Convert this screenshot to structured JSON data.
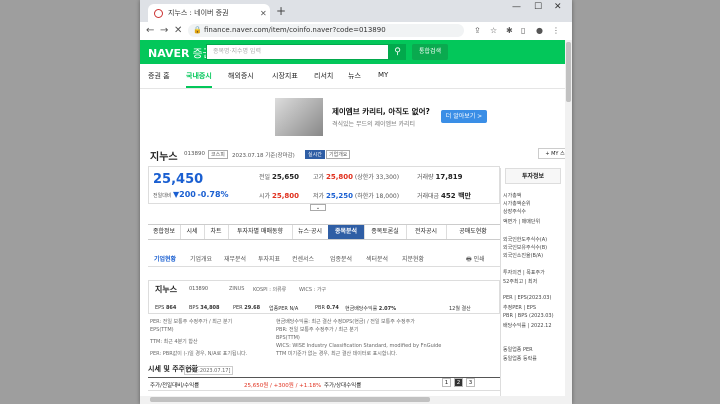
{
  "browser": {
    "tab_title": "지누스 : 네이버 증권",
    "url": "finance.naver.com/item/coinfo.naver?code=013890"
  },
  "header": {
    "logo": "NAVER",
    "logo_sub": "증권",
    "search_placeholder": "종목명·지수명 입력",
    "search_button": "통합검색"
  },
  "nav": {
    "items": [
      "증권 홈",
      "국내증시",
      "해외증시",
      "시장지표",
      "리서치",
      "뉴스",
      "MY"
    ]
  },
  "ad": {
    "headline": "제이엠브 카리티, 아직도 없어?",
    "sub": "격식있는 무드의 제이엠브 카리티",
    "button": "더 알아보기 >"
  },
  "stock": {
    "name": "지누스",
    "code": "013890",
    "market_tag": "코스피",
    "date": "2023.07.18 기준(장마감)",
    "tag1": "실시간",
    "tag2": "기업개요",
    "my_stock": "+ MY 스",
    "price": "25,450",
    "change_label": "전일대비",
    "change": "▼200",
    "change_pct": "-0.78%",
    "prev_label": "전일",
    "prev": "25,650",
    "high_label": "고가",
    "high": "25,800",
    "high_limit": "(상한가 33,300)",
    "volume_label": "거래량",
    "volume": "17,819",
    "open_label": "시가",
    "open": "25,800",
    "low_label": "저가",
    "low": "25,250",
    "low_limit": "(하한가 18,000)",
    "amount_label": "거래대금",
    "amount": "452 백만"
  },
  "tabs": [
    "종합정보",
    "시세",
    "차트",
    "투자자별 매매동향",
    "뉴스·공시",
    "종목분석",
    "종목토론실",
    "전자공시",
    "공매도현황"
  ],
  "subtabs": [
    "기업현황",
    "기업개요",
    "재무분석",
    "투자지표",
    "컨센서스",
    "업종분석",
    "섹터분석",
    "지분현황"
  ],
  "print_label": "인쇄",
  "company": {
    "name": "지누스",
    "code": "013890",
    "info1": "ZINUS",
    "info2": "KOSPI : 의류류",
    "info3": "WICS : 가구",
    "eps_label": "EPS",
    "eps": "864",
    "bps_label": "BPS",
    "bps": "34,808",
    "per_label": "PER",
    "per": "29.68",
    "iper_label": "업종PER N/A",
    "pbr_label": "PBR",
    "pbr": "0.74",
    "div_label": "현금배당수익률",
    "div": "2.07%",
    "fy": "12월 결산"
  },
  "notes": {
    "left": [
      "PER: 전일 보통주 수정주가 / 최근 분기",
      "EPS(TTM)",
      "TTM: 최근 4분기 합산",
      "PER: PBR값이 (-)일 경우, N/A로 표기됩니다."
    ],
    "right": [
      "현금배당수익률: 최근 결산 수정DPS(현금) / 전일 보통주 수정주가",
      "PBR: 전일 보통주 수정주가 / 최근 분기",
      "BPS(TTM)",
      "WICS: WISE Industry Classification Standard, modified by FnGuide",
      "TTM 미기준가 없는 경우, 최근 결산 데이터로 표시합니다."
    ]
  },
  "price_section": {
    "title": "시세 및 주주현황",
    "date": "[기준:2023.07.17]",
    "row_label1": "주가/전일대비/수익률",
    "row_value1": "25,650원 / +300원 / +1.18%",
    "row_label2": "주가/상대수익률",
    "pages": [
      "1",
      "2",
      "3"
    ]
  },
  "sidebar": {
    "title": "투자정보",
    "items": [
      "시가총액",
      "시가총액순위",
      "상장주식수",
      "액면가 | 매매단위",
      "외국인한도주식수(A)",
      "외국인보유주식수(B)",
      "외국인소진율(B/A)",
      "투자의견 | 목표주가",
      "52주최고 | 최저",
      "PER | EPS(2023.03)",
      "추정PER | EPS",
      "PBR | BPS (2023.03)",
      "배당수익률 | 2022.12",
      "동일업종 PER",
      "동일업종 등락률"
    ]
  }
}
